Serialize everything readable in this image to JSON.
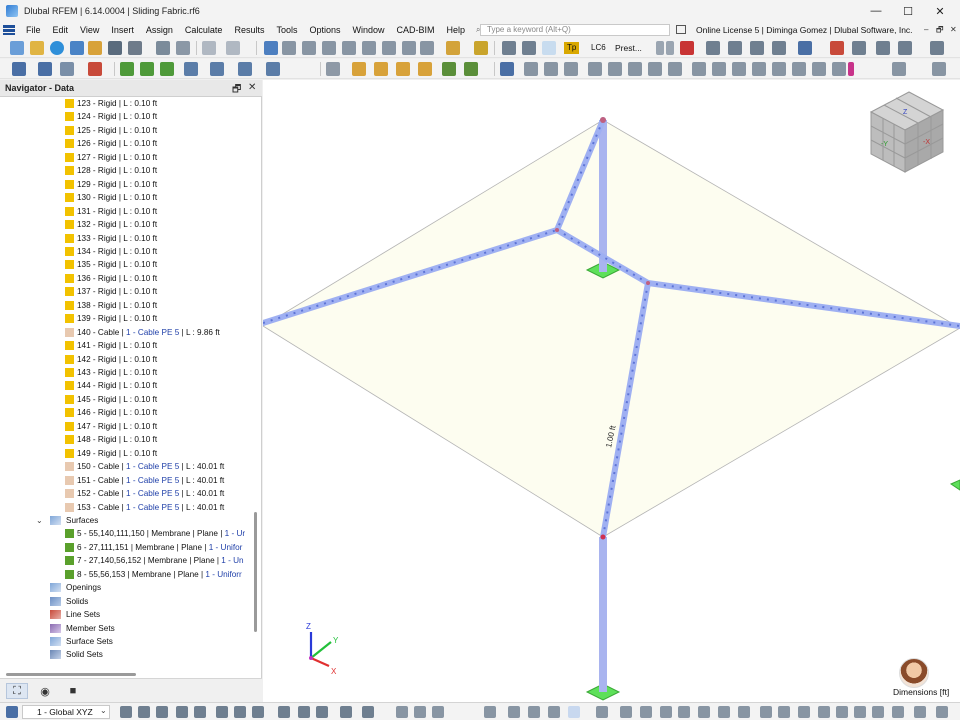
{
  "window": {
    "title": "Dlubal RFEM | 6.14.0004 | Sliding Fabric.rf6",
    "minimize": "—",
    "maximize": "☐",
    "close": "✕"
  },
  "menu": {
    "items": [
      "File",
      "Edit",
      "View",
      "Insert",
      "Assign",
      "Calculate",
      "Results",
      "Tools",
      "Options",
      "Window",
      "CAD-BIM",
      "Help"
    ],
    "search_placeholder": "Type a keyword (Alt+Q)",
    "license": "Online License 5 | Diminga Gomez | Dlubal Software, Inc.",
    "mdi_controls": [
      "–",
      "🗗",
      "✕"
    ]
  },
  "toolbar": {
    "load_type": "Tp",
    "load_case": "LC6",
    "combo_value": "Prest..."
  },
  "navigator": {
    "title": "Navigator - Data",
    "pin": "🗗",
    "close": "✕",
    "members": [
      {
        "label": "123 - Rigid | L : 0.10 ft",
        "kind": "rigid"
      },
      {
        "label": "124 - Rigid | L : 0.10 ft",
        "kind": "rigid"
      },
      {
        "label": "125 - Rigid | L : 0.10 ft",
        "kind": "rigid"
      },
      {
        "label": "126 - Rigid | L : 0.10 ft",
        "kind": "rigid"
      },
      {
        "label": "127 - Rigid | L : 0.10 ft",
        "kind": "rigid"
      },
      {
        "label": "128 - Rigid | L : 0.10 ft",
        "kind": "rigid"
      },
      {
        "label": "129 - Rigid | L : 0.10 ft",
        "kind": "rigid"
      },
      {
        "label": "130 - Rigid | L : 0.10 ft",
        "kind": "rigid"
      },
      {
        "label": "131 - Rigid | L : 0.10 ft",
        "kind": "rigid"
      },
      {
        "label": "132 - Rigid | L : 0.10 ft",
        "kind": "rigid"
      },
      {
        "label": "133 - Rigid | L : 0.10 ft",
        "kind": "rigid"
      },
      {
        "label": "134 - Rigid | L : 0.10 ft",
        "kind": "rigid"
      },
      {
        "label": "135 - Rigid | L : 0.10 ft",
        "kind": "rigid"
      },
      {
        "label": "136 - Rigid | L : 0.10 ft",
        "kind": "rigid"
      },
      {
        "label": "137 - Rigid | L : 0.10 ft",
        "kind": "rigid"
      },
      {
        "label": "138 - Rigid | L : 0.10 ft",
        "kind": "rigid"
      },
      {
        "label": "139 - Rigid | L : 0.10 ft",
        "kind": "rigid"
      },
      {
        "label": "140 - Cable | ",
        "blue": "1 - Cable PE 5",
        "tail": " | L : 9.86 ft",
        "kind": "cable"
      },
      {
        "label": "141 - Rigid | L : 0.10 ft",
        "kind": "rigid"
      },
      {
        "label": "142 - Rigid | L : 0.10 ft",
        "kind": "rigid"
      },
      {
        "label": "143 - Rigid | L : 0.10 ft",
        "kind": "rigid"
      },
      {
        "label": "144 - Rigid | L : 0.10 ft",
        "kind": "rigid"
      },
      {
        "label": "145 - Rigid | L : 0.10 ft",
        "kind": "rigid"
      },
      {
        "label": "146 - Rigid | L : 0.10 ft",
        "kind": "rigid"
      },
      {
        "label": "147 - Rigid | L : 0.10 ft",
        "kind": "rigid"
      },
      {
        "label": "148 - Rigid | L : 0.10 ft",
        "kind": "rigid"
      },
      {
        "label": "149 - Rigid | L : 0.10 ft",
        "kind": "rigid"
      },
      {
        "label": "150 - Cable | ",
        "blue": "1 - Cable PE 5",
        "tail": " | L : 40.01 ft",
        "kind": "cable"
      },
      {
        "label": "151 - Cable | ",
        "blue": "1 - Cable PE 5",
        "tail": " | L : 40.01 ft",
        "kind": "cable"
      },
      {
        "label": "152 - Cable | ",
        "blue": "1 - Cable PE 5",
        "tail": " | L : 40.01 ft",
        "kind": "cable"
      },
      {
        "label": "153 - Cable | ",
        "blue": "1 - Cable PE 5",
        "tail": " | L : 40.01 ft",
        "kind": "cable"
      }
    ],
    "surfaces_label": "Surfaces",
    "surfaces": [
      {
        "label": "5 - 55,140,111,150 | Membrane | Plane | ",
        "blue": "1 - Ur"
      },
      {
        "label": "6 - 27,111,151 | Membrane | Plane | ",
        "blue": "1 - Unifor"
      },
      {
        "label": "7 - 27,140,56,152 | Membrane | Plane | ",
        "blue": "1 - Un"
      },
      {
        "label": "8 - 55,56,153 | Membrane | Plane | ",
        "blue": "1 - Uniforr"
      }
    ],
    "folders": [
      "Openings",
      "Solids",
      "Line Sets",
      "Member Sets",
      "Surface Sets",
      "Solid Sets"
    ],
    "colors": {
      "rigid": "#f2c200",
      "cable": "#e8c9b0",
      "surface": "#5aa02c"
    }
  },
  "viewport": {
    "member_dimension": "1.00 ft",
    "dimension_legend": "Dimensions [ft]",
    "axes": {
      "x": "X",
      "y": "Y",
      "z": "Z"
    }
  },
  "statusbar": {
    "coord_system": "1 - Global XYZ"
  }
}
